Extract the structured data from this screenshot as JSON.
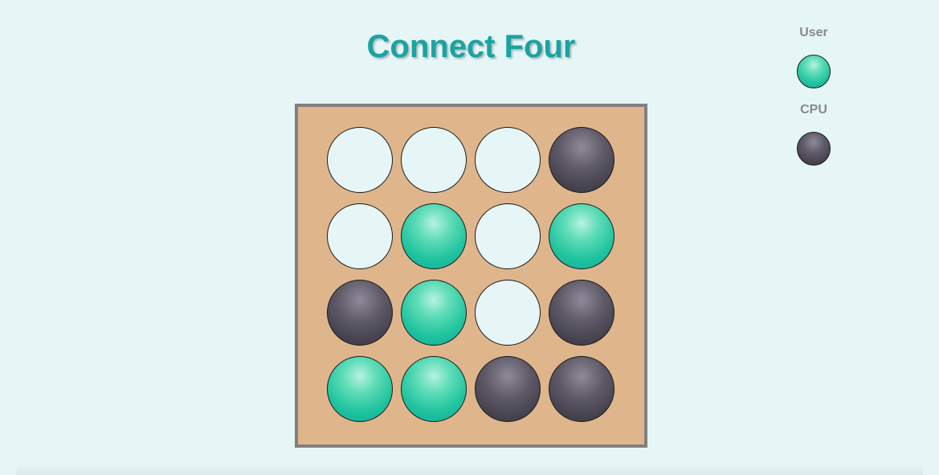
{
  "title": "Connect Four",
  "colors": {
    "background": "#e6f6f6",
    "title": "#1aa3a3",
    "board": "#dfb68c",
    "board_border": "#808080",
    "user_disc": "#1fc49e",
    "cpu_disc": "#45424e",
    "empty_cell": "#e6f6f6"
  },
  "legend": {
    "user_label": "User",
    "cpu_label": "CPU"
  },
  "board": {
    "rows": 4,
    "columns": 4,
    "cells": [
      [
        "empty",
        "empty",
        "empty",
        "cpu"
      ],
      [
        "empty",
        "user",
        "empty",
        "user"
      ],
      [
        "cpu",
        "user",
        "empty",
        "cpu"
      ],
      [
        "user",
        "user",
        "cpu",
        "cpu"
      ]
    ]
  }
}
